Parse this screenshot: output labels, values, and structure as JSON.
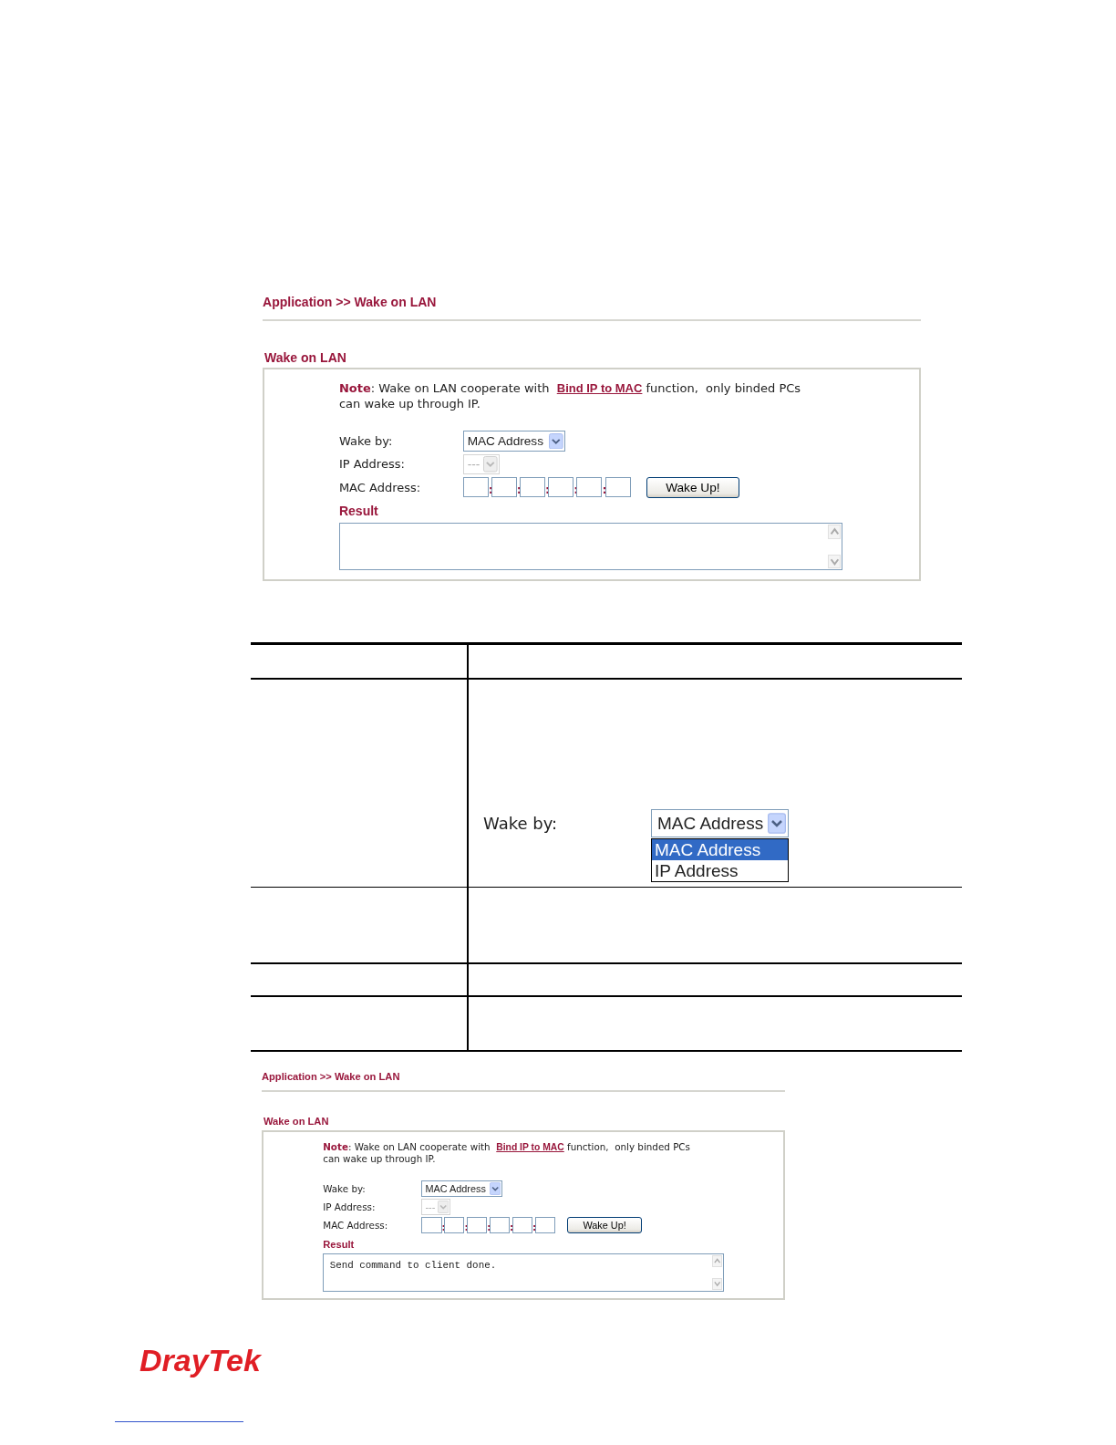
{
  "screenshots": [
    {
      "breadcrumb": "Application >> Wake on LAN",
      "section_title": "Wake on LAN",
      "note": {
        "label": "Note",
        "text_before": ": Wake on LAN cooperate with  ",
        "link": "Bind IP to MAC",
        "text_after": " function,  only binded PCs",
        "second_line": "can wake up through IP."
      },
      "wake_by": {
        "label": "Wake by:",
        "value": "MAC Address"
      },
      "ip_address": {
        "label": "IP Address:",
        "value": "---",
        "disabled": true
      },
      "mac_address": {
        "label": "MAC Address:",
        "separator": ":"
      },
      "button": "Wake Up!",
      "result": {
        "label": "Result"
      }
    },
    {
      "breadcrumb": "Application >> Wake on LAN",
      "section_title": "Wake on LAN",
      "note": {
        "label": "Note",
        "text_before": ": Wake on LAN cooperate with  ",
        "link": "Bind IP to MAC",
        "text_after": " function,  only binded PCs",
        "second_line": "can wake up through IP."
      },
      "wake_by": {
        "label": "Wake by:",
        "value": "MAC Address"
      },
      "ip_address": {
        "label": "IP Address:",
        "value": "---",
        "disabled": true
      },
      "mac_address": {
        "label": "MAC Address:",
        "separator": ":"
      },
      "button": "Wake Up!",
      "result": {
        "label": "Result",
        "value": "Send command to client done."
      }
    }
  ],
  "table": {
    "wake_by_example": {
      "label": "Wake by:",
      "value": "MAC Address",
      "options": [
        {
          "label": "MAC Address",
          "selected": true
        },
        {
          "label": "IP Address",
          "selected": false
        }
      ]
    }
  },
  "logo": {
    "text": "DrayTek"
  }
}
